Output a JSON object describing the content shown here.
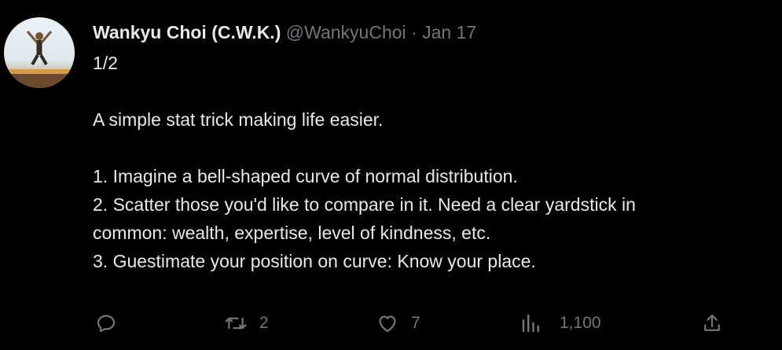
{
  "author": {
    "display_name": "Wankyu Choi (C.W.K.)",
    "handle": "@WankyuChoi",
    "separator": "·",
    "date": "Jan 17"
  },
  "tweet": {
    "lines": [
      "1/2",
      "",
      "A simple stat trick making life easier.",
      "",
      "1. Imagine a bell-shaped curve of normal distribution.",
      "2. Scatter those you'd like to compare in it. Need a clear yardstick in",
      "common: wealth, expertise, level of kindness, etc.",
      "3. Guestimate your position on curve: Know your place."
    ]
  },
  "actions": {
    "reply": {
      "icon": "reply-icon"
    },
    "retweet": {
      "icon": "retweet-icon",
      "count": "2"
    },
    "like": {
      "icon": "heart-icon",
      "count": "7"
    },
    "views": {
      "icon": "views-icon",
      "count": "1,100"
    },
    "share": {
      "icon": "share-icon"
    }
  },
  "colors": {
    "background": "#000000",
    "text": "#e7e9ea",
    "muted": "#71767b"
  }
}
